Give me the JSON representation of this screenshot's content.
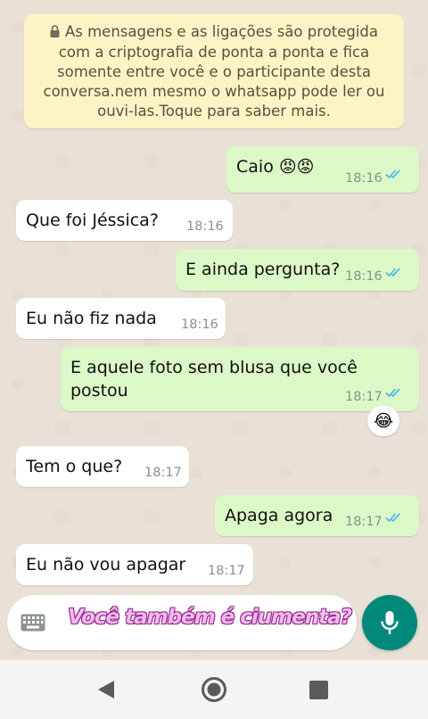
{
  "encryption_notice": {
    "line1": "As mensagens e as ligações são protegida",
    "line2": "com a criptografia de ponta a ponta e fica",
    "line3": "somente entre você e o participante desta",
    "line4": "conversa.nem mesmo o whatsapp pode ler ou",
    "line5": "ouvi-las.Toque para saber mais."
  },
  "messages": [
    {
      "direction": "outgoing",
      "text": "Caio 😡😡",
      "time": "18:16",
      "status": "read"
    },
    {
      "direction": "incoming",
      "text": "Que foi Jéssica?",
      "time": "18:16"
    },
    {
      "direction": "outgoing",
      "text": "E ainda pergunta?",
      "time": "18:16",
      "status": "read"
    },
    {
      "direction": "incoming",
      "text": "Eu não fiz nada",
      "time": "18:16"
    },
    {
      "direction": "outgoing",
      "line1": "E aquele foto sem blusa que você",
      "line2": "postou",
      "time": "18:17",
      "status": "read",
      "reaction": "😂"
    },
    {
      "direction": "incoming",
      "text": "Tem o que?",
      "time": "18:17"
    },
    {
      "direction": "outgoing",
      "text": "Apaga agora",
      "time": "18:17",
      "status": "read"
    },
    {
      "direction": "incoming",
      "text": "Eu não vou apagar",
      "time": "18:17"
    }
  ],
  "composer": {
    "typed_overlay": "Você também é ciumenta?",
    "keyboard_icon": "keyboard-icon",
    "mic_icon": "microphone-icon"
  },
  "colors": {
    "outgoing_bubble": "#dcf8c6",
    "incoming_bubble": "#ffffff",
    "notice_bg": "#fdf4c5",
    "read_ticks": "#4fb6ec",
    "mic_button": "#00897b"
  },
  "navigation": {
    "back": "back-icon",
    "home": "home-icon",
    "recents": "recents-icon"
  }
}
